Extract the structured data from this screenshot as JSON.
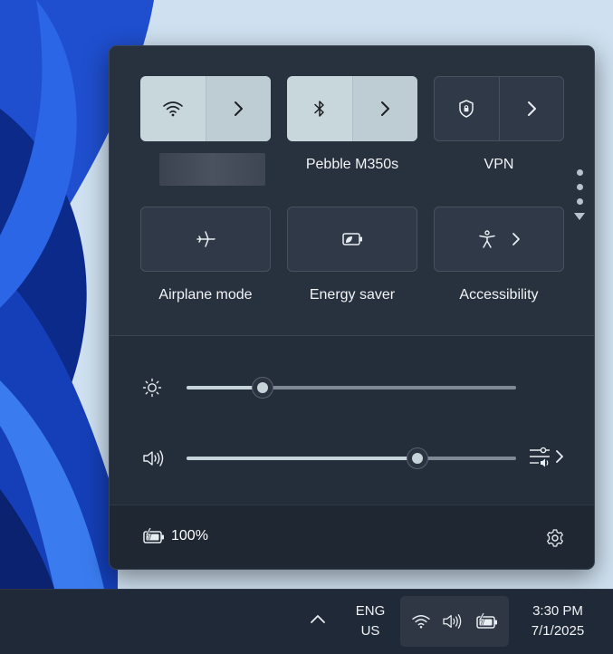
{
  "quick_settings": {
    "tiles_row1": [
      {
        "id": "wifi",
        "label": "",
        "icon": "wifi-icon",
        "state": "on",
        "has_arrow": true
      },
      {
        "id": "bluetooth",
        "label": "Pebble M350s",
        "icon": "bluetooth-icon",
        "state": "on",
        "has_arrow": true
      },
      {
        "id": "vpn",
        "label": "VPN",
        "icon": "shield-icon",
        "state": "off",
        "has_arrow": true
      }
    ],
    "tiles_row2": [
      {
        "id": "airplane",
        "label": "Airplane mode",
        "icon": "airplane-icon",
        "state": "off"
      },
      {
        "id": "energy_saver",
        "label": "Energy saver",
        "icon": "battery-leaf-icon",
        "state": "off"
      },
      {
        "id": "accessibility",
        "label": "Accessibility",
        "icon": "accessibility-icon",
        "state": "off",
        "has_arrow": true
      }
    ],
    "pager": {
      "dots": 3,
      "current": 1
    },
    "brightness": {
      "icon": "sun-icon",
      "value": 0.23
    },
    "volume": {
      "icon": "speaker-icon",
      "value": 0.7,
      "mixer_icon": "audio-mixer-icon"
    },
    "battery": {
      "icon": "battery-charging-icon",
      "percent": "100%"
    },
    "settings_icon": "gear-icon"
  },
  "taskbar": {
    "language": {
      "line1": "ENG",
      "line2": "US"
    },
    "tray_icons": [
      "wifi-icon",
      "speaker-icon",
      "battery-charging-icon"
    ],
    "clock": {
      "time": "3:30 PM",
      "date": "7/1/2025"
    }
  },
  "colors": {
    "tile_on": "#c7d7dc",
    "panel_bg": "#27303d",
    "taskbar_bg": "#1f2937"
  }
}
